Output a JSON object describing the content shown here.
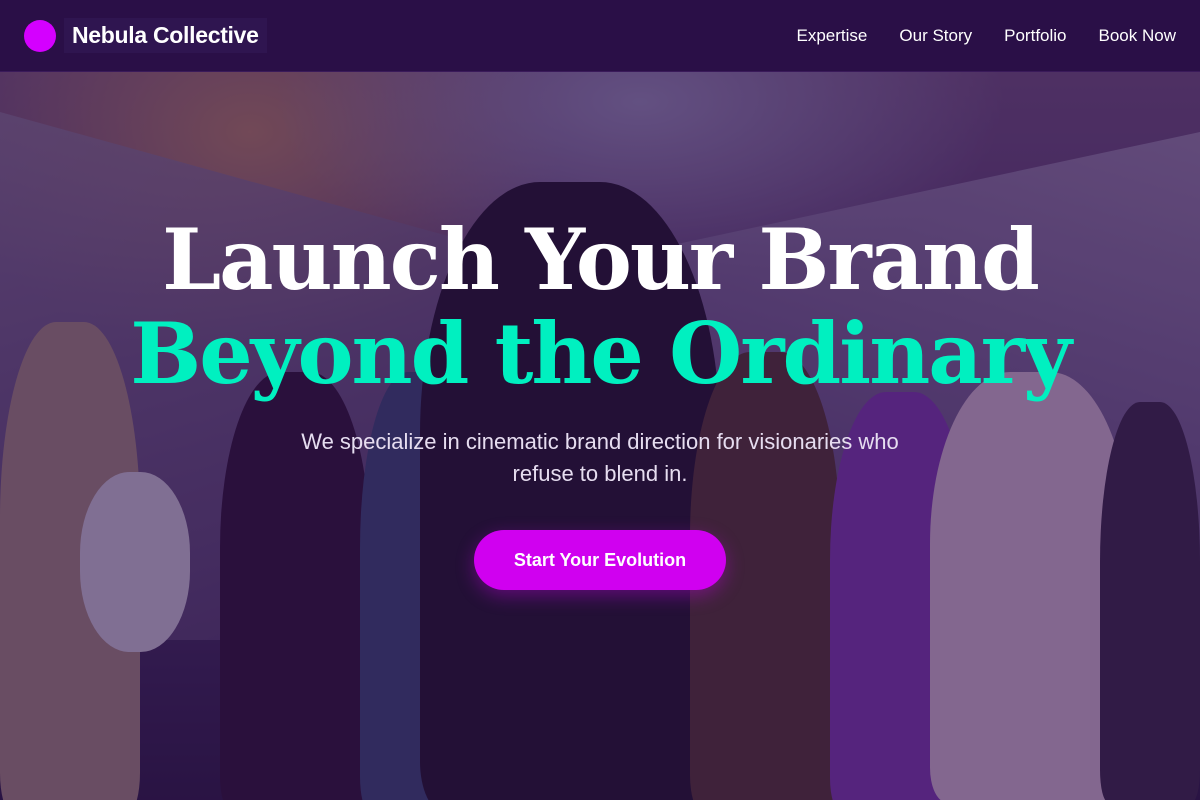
{
  "brand": {
    "name": "Nebula Collective",
    "logo_color": "#d400ff"
  },
  "nav": {
    "links": [
      {
        "label": "Expertise"
      },
      {
        "label": "Our Story"
      },
      {
        "label": "Portfolio"
      },
      {
        "label": "Book Now"
      }
    ]
  },
  "hero": {
    "headline_line1": "Launch Your Brand",
    "headline_line2": "Beyond the Ordinary",
    "subtitle": "We specialize in cinematic brand direction for visionaries who refuse to blend in.",
    "cta_label": "Start Your Evolution"
  },
  "colors": {
    "nav_background": "#2a0f47",
    "accent_teal": "#00f0c0",
    "accent_magenta": "#d000f0",
    "text_light": "#ffffff"
  }
}
